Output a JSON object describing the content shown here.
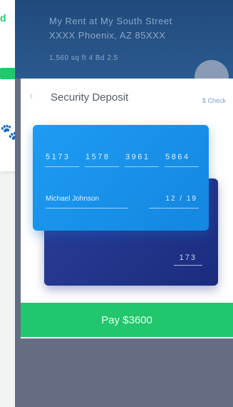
{
  "background_app": {
    "logo_fragment": "d",
    "paw_icon": "paw-icon"
  },
  "header": {
    "address_line_1": "My Rent at My South Street",
    "address_line_2": "XXXX Phoenix, AZ 85XXX",
    "meta_line": "1,560 sq ft   4 Bd   2.5"
  },
  "sheet": {
    "title": "Security Deposit",
    "action": "$ Check",
    "back_icon": "back-arrow-icon"
  },
  "card": {
    "number_groups": [
      "5173",
      "1578",
      "3961",
      "5864"
    ],
    "holder_name": "Michael Johnson",
    "expiry": "12 / 19",
    "cvv": "173"
  },
  "pay_button": {
    "label": "Pay $3600"
  },
  "colors": {
    "primary_blue": "#1e9cf2",
    "card_back": "#1b2c7e",
    "pay_green": "#22c66d",
    "header_navy": "#214a7c"
  }
}
